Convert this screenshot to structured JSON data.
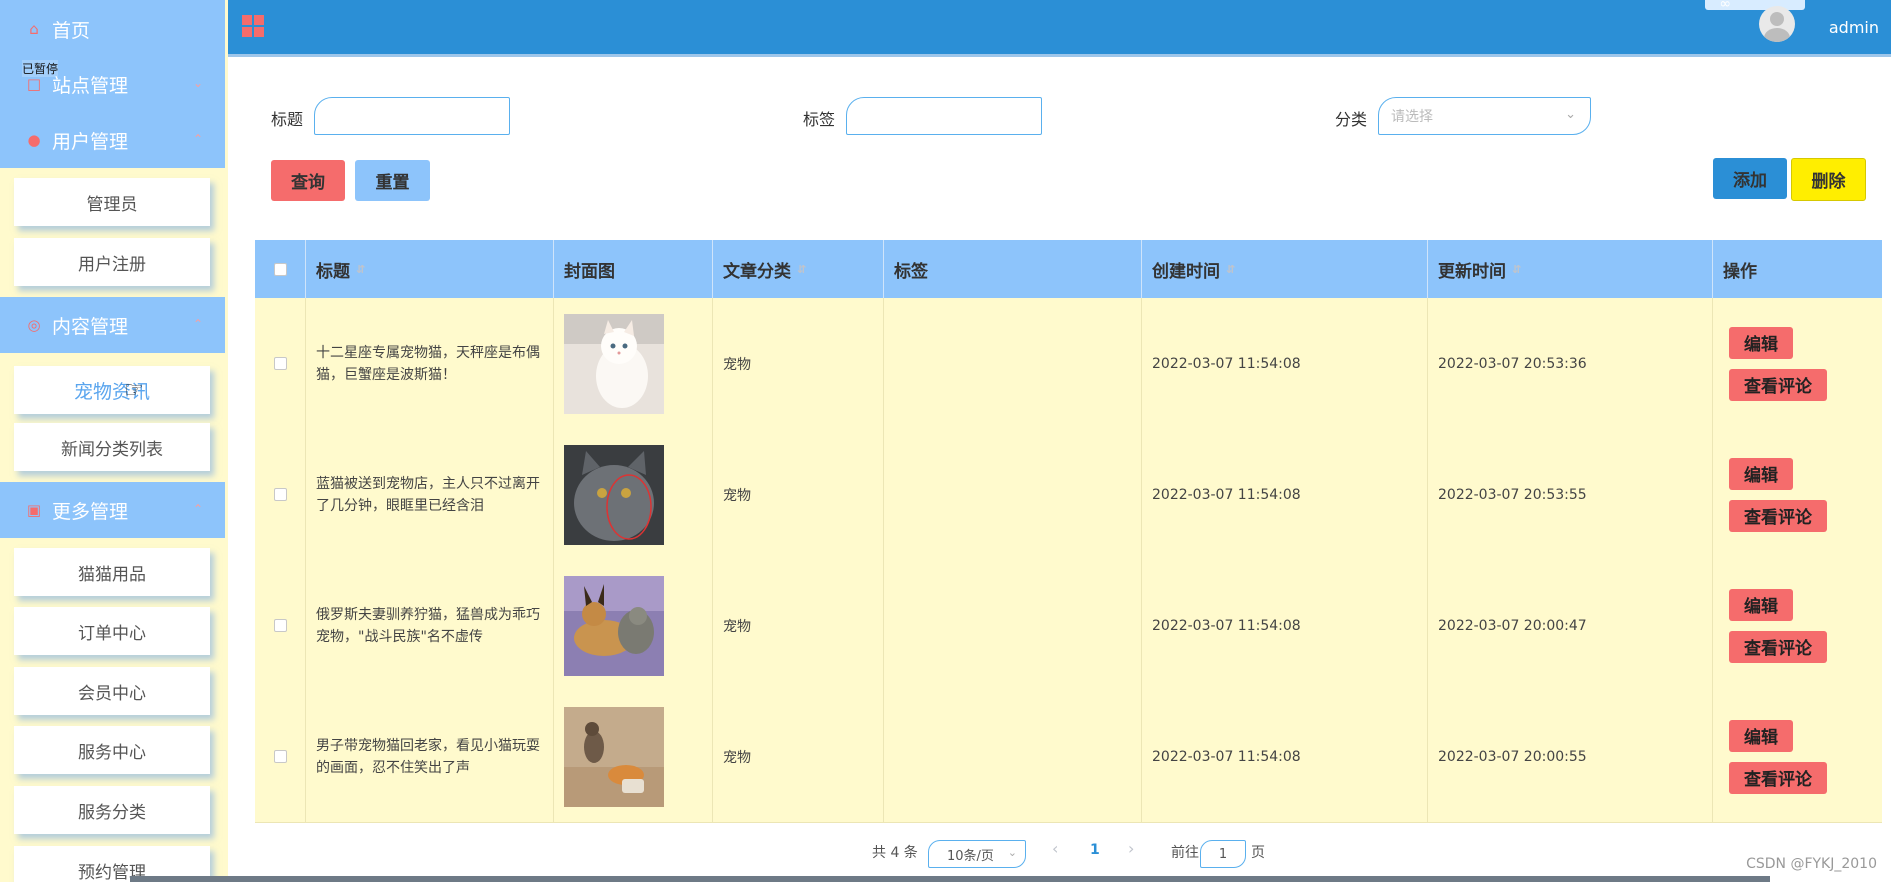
{
  "sidebar": {
    "home": "首页",
    "tooltip": "已暂停",
    "groups": [
      {
        "label": "站点管理",
        "icon": "monitor-icon"
      },
      {
        "label": "用户管理",
        "icon": "user-icon"
      },
      {
        "label": "内容管理",
        "icon": "content-icon"
      },
      {
        "label": "更多管理",
        "icon": "more-icon"
      }
    ],
    "items": [
      "管理员",
      "用户注册",
      "宠物资讯",
      "新闻分类列表",
      "猫猫用品",
      "订单中心",
      "会员中心",
      "服务中心",
      "服务分类",
      "预约管理"
    ]
  },
  "header": {
    "username": "admin"
  },
  "search": {
    "title_label": "标题",
    "tag_label": "标签",
    "category_label": "分类",
    "category_placeholder": "请选择",
    "query_button": "查询",
    "reset_button": "重置",
    "add_button": "添加",
    "delete_button": "删除"
  },
  "table": {
    "columns": [
      "标题",
      "封面图",
      "文章分类",
      "标签",
      "创建时间",
      "更新时间",
      "操作"
    ],
    "rows": [
      {
        "title": "十二星座专属宠物猫，天秤座是布偶猫，巨蟹座是波斯猫！",
        "category": "宠物",
        "tag": "",
        "created": "2022-03-07 11:54:08",
        "updated": "2022-03-07 20:53:36"
      },
      {
        "title": "蓝猫被送到宠物店，主人只不过离开了几分钟，眼眶里已经含泪",
        "category": "宠物",
        "tag": "",
        "created": "2022-03-07 11:54:08",
        "updated": "2022-03-07 20:53:55"
      },
      {
        "title": "俄罗斯夫妻驯养狞猫，猛兽成为乖巧宠物，\"战斗民族\"名不虚传",
        "category": "宠物",
        "tag": "",
        "created": "2022-03-07 11:54:08",
        "updated": "2022-03-07 20:00:47"
      },
      {
        "title": "男子带宠物猫回老家，看见小猫玩耍的画面，忍不住笑出了声",
        "category": "宠物",
        "tag": "",
        "created": "2022-03-07 11:54:08",
        "updated": "2022-03-07 20:00:55"
      }
    ],
    "edit_label": "编辑",
    "comment_label": "查看评论"
  },
  "pagination": {
    "total": "共 4 条",
    "page_size": "10条/页",
    "prev": "‹",
    "current": "1",
    "next": "›",
    "goto_prefix": "前往",
    "goto_value": "1",
    "goto_suffix": "页"
  },
  "watermark": "CSDN @FYKJ_2010",
  "colors": {
    "header": "#2b8fd6",
    "sidebar_group": "#8dc4fb",
    "panel": "#fffacd",
    "danger": "#f56c6c",
    "add": "#2b8fd6",
    "delete": "#ffee00"
  }
}
